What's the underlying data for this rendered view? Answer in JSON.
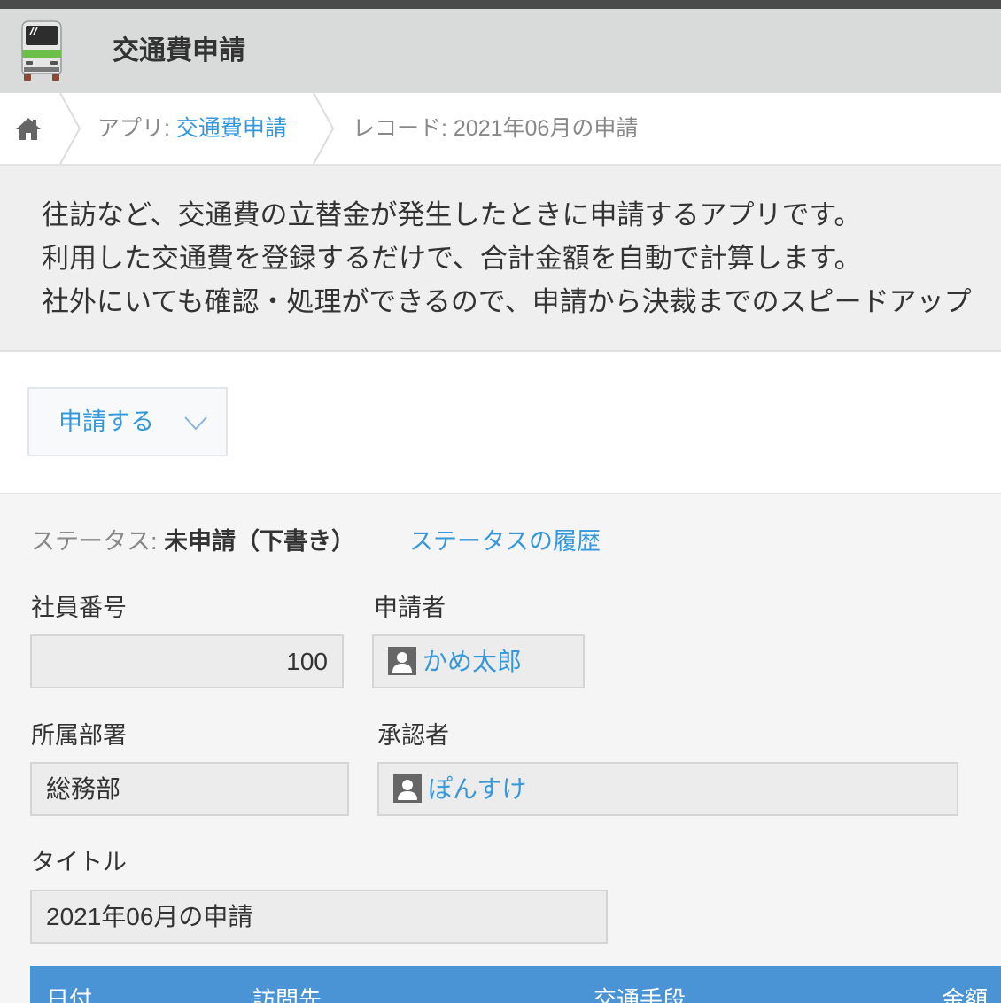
{
  "app": {
    "title": "交通費申請",
    "icon": "train-icon"
  },
  "breadcrumb": {
    "home_icon": "home-icon",
    "app_prefix": "アプリ: ",
    "app_name": "交通費申請",
    "record_label": "レコード: 2021年06月の申請"
  },
  "description": {
    "lines": [
      "往訪など、交通費の立替金が発生したときに申請するアプリです。",
      "利用した交通費を登録するだけで、合計金額を自動で計算します。",
      "社外にいても確認・処理ができるので、申請から決裁までのスピードアップ"
    ]
  },
  "actions": {
    "submit_label": "申請する",
    "submit_icon": "chevron-down-icon"
  },
  "status": {
    "prefix": "ステータス: ",
    "value": "未申請（下書き）",
    "history_link": "ステータスの履歴"
  },
  "fields": {
    "employee_number": {
      "label": "社員番号",
      "value": "100"
    },
    "applicant": {
      "label": "申請者",
      "value": "かめ太郎",
      "icon": "user-icon"
    },
    "department": {
      "label": "所属部署",
      "value": "総務部"
    },
    "approver": {
      "label": "承認者",
      "value": "ぽんすけ",
      "icon": "user-icon"
    },
    "title": {
      "label": "タイトル",
      "value": "2021年06月の申請"
    }
  },
  "table": {
    "columns": [
      "日付",
      "訪問先",
      "交通手段",
      "金額"
    ]
  },
  "colors": {
    "link": "#3498db",
    "table_header": "#4a94d6"
  }
}
